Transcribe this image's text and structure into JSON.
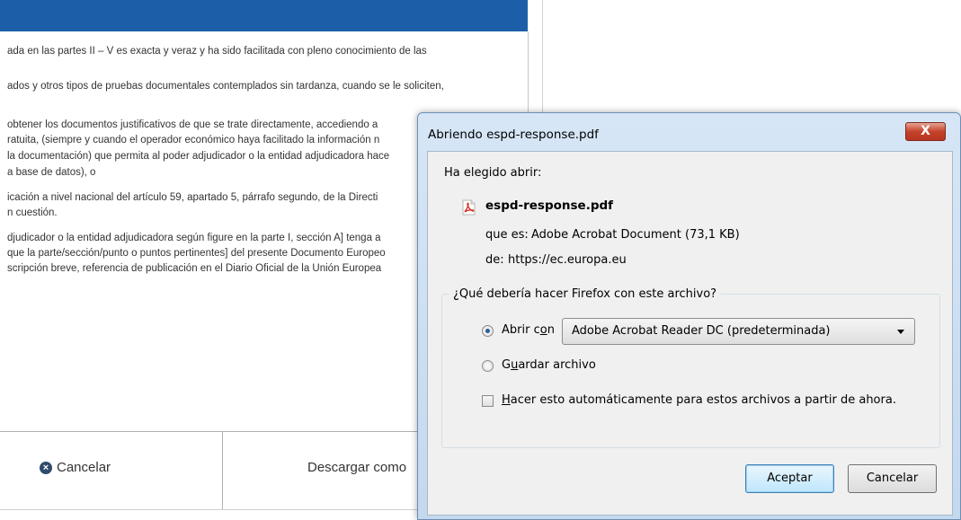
{
  "background": {
    "paragraphs": [
      "ada en las partes II – V es exacta y veraz y ha sido facilitada con pleno conocimiento de las",
      "ados y otros tipos de pruebas documentales contemplados sin tardanza, cuando se le soliciten,",
      "obtener los documentos justificativos de que se trate directamente, accediendo a",
      "ratuita, (siempre y cuando el operador económico haya facilitado la información n",
      "la documentación) que permita al poder adjudicador o la entidad adjudicadora hace",
      "a base de datos), o",
      "icación a nivel nacional del artículo 59, apartado 5, párrafo segundo, de la Directi",
      "n cuestión.",
      "djudicador o la entidad adjudicadora según figure en la parte I, sección A] tenga a",
      "que la parte/sección/punto o puntos pertinentes] del presente Documento Europeo",
      "scripción breve, referencia de publicación en el Diario Oficial de la Unión Europea"
    ],
    "footer": {
      "cancel_label": "Cancelar",
      "download_label": "Descargar como"
    },
    "colors": {
      "header_bar": "#1c5fa8"
    }
  },
  "dialog": {
    "title": "Abriendo espd-response.pdf",
    "close_label": "X",
    "chosen_label": "Ha elegido abrir:",
    "file_icon": "pdf-file-icon",
    "filename": "espd-response.pdf",
    "type_label": "que es:",
    "type_value": "Adobe Acrobat Document (73,1 KB)",
    "from_label": "de:",
    "from_value": "https://ec.europa.eu",
    "group_title": "¿Qué debería hacer Firefox con este archivo?",
    "open_with": {
      "pre": "Abrir c",
      "key": "o",
      "post": "n",
      "selected": true
    },
    "app_selected": "Adobe Acrobat Reader DC  (predeterminada)",
    "save_file": {
      "pre": "G",
      "key": "u",
      "post": "ardar archivo",
      "selected": false
    },
    "auto": {
      "pre": "",
      "key": "H",
      "post": "acer esto automáticamente para estos archivos a partir de ahora.",
      "checked": false
    },
    "ok_label": "Aceptar",
    "cancel_label": "Cancelar"
  }
}
